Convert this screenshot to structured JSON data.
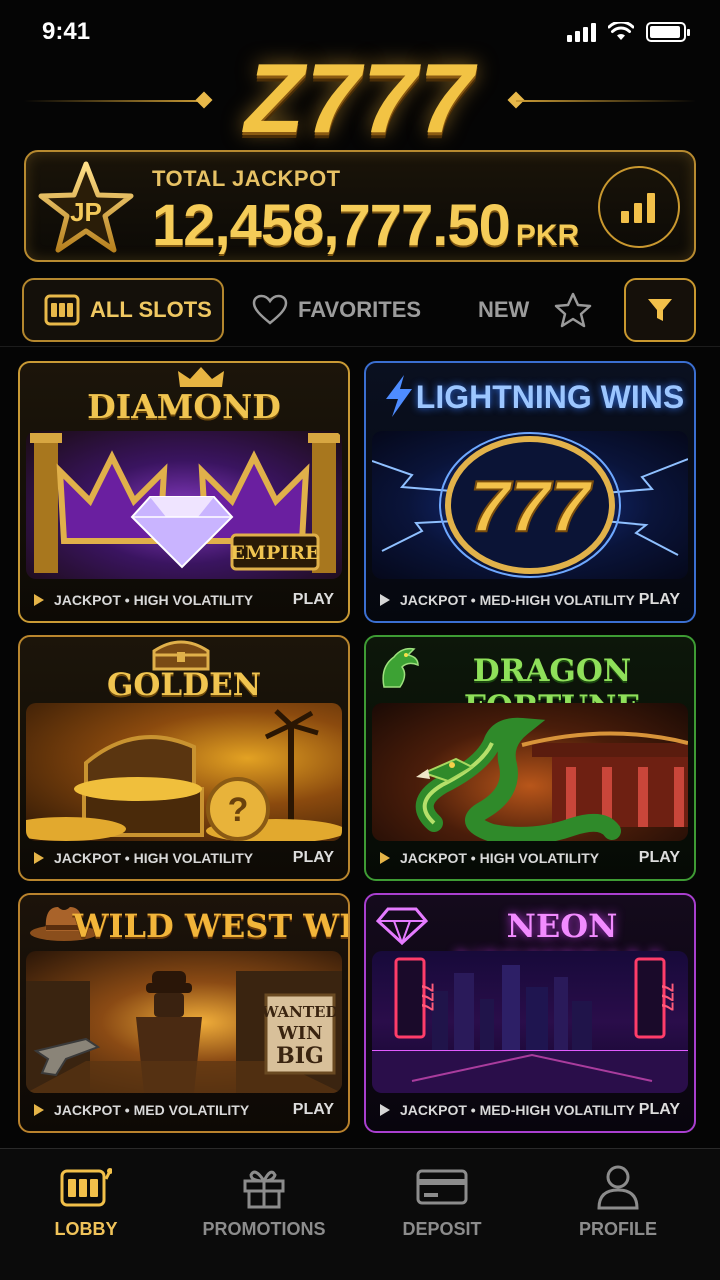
{
  "status": {
    "time": "9:41"
  },
  "logo": {
    "text": "Z777"
  },
  "jackpot": {
    "badge": "JP",
    "label": "TOTAL JACKPOT",
    "amount": "12,458,777.50",
    "currency": "PKR"
  },
  "tabs": [
    {
      "label": "ALL SLOTS",
      "icon": "slot-machine-icon",
      "active": true
    },
    {
      "label": "FAVORITES",
      "icon": "heart-icon",
      "active": false
    },
    {
      "label": "NEW",
      "icon": "star-icon",
      "active": false
    }
  ],
  "games": [
    {
      "title": "DIAMOND EMPIRE",
      "sign": "EMPIRE",
      "info": "JACKPOT • HIGH VOLATILITY",
      "play": "PLAY",
      "accent": "#d4a43a"
    },
    {
      "title": "LIGHTNING WINS",
      "sign": "777",
      "info": "JACKPOT • MED-HIGH VOLATILITY",
      "play": "PLAY",
      "accent": "#3b6fd1"
    },
    {
      "title": "GOLDEN TREASURE",
      "sign": "?",
      "info": "JACKPOT • HIGH VOLATILITY",
      "play": "PLAY",
      "accent": "#d4a43a"
    },
    {
      "title": "DRAGON FORTUNE",
      "sign": "",
      "info": "JACKPOT • HIGH VOLATILITY",
      "play": "PLAY",
      "accent": "#3e9b34"
    },
    {
      "title": "WILD WEST WIN",
      "sign_lines": [
        "WANTED",
        "WIN",
        "BIG"
      ],
      "info": "JACKPOT • MED VOLATILITY",
      "play": "PLAY",
      "accent": "#b9822d"
    },
    {
      "title": "NEON NIGHTFALL",
      "sign": "777",
      "info": "JACKPOT • MED-HIGH VOLATILITY",
      "play": "PLAY",
      "accent": "#b03fd1"
    }
  ],
  "nav": [
    {
      "label": "LOBBY",
      "icon": "slot-machine-icon",
      "active": true
    },
    {
      "label": "PROMOTIONS",
      "icon": "gift-icon",
      "active": false
    },
    {
      "label": "DEPOSIT",
      "icon": "card-icon",
      "active": false
    },
    {
      "label": "PROFILE",
      "icon": "user-icon",
      "active": false
    }
  ]
}
